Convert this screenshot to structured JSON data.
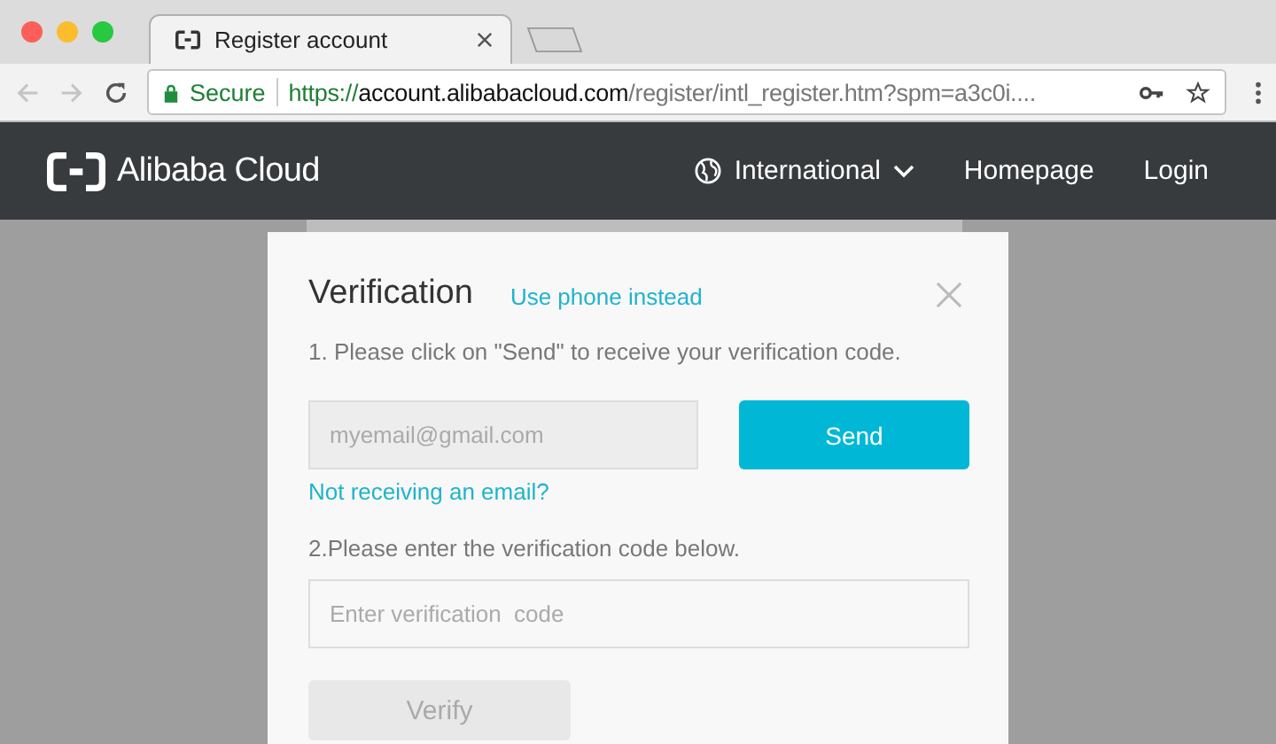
{
  "browser": {
    "tab": {
      "title": "Register account",
      "selected": true
    },
    "address_bar": {
      "security": "Secure",
      "url_scheme": "https://",
      "url_host": "account.alibabacloud.com",
      "url_path": "/register/intl_register.htm?spm=a3c0i...."
    }
  },
  "header": {
    "logo": "Alibaba Cloud",
    "nav": [
      {
        "label": "International",
        "kind": "region"
      },
      {
        "label": "Homepage",
        "kind": "link"
      },
      {
        "label": "Login",
        "kind": "link"
      }
    ]
  },
  "dialog": {
    "title": "Verification",
    "switch_link": "Use phone instead",
    "step1": "1. Please click on \"Send\" to receive your verification code.",
    "email_field": {
      "placeholder": "myemail@gmail.com"
    },
    "send_button": {
      "label": "Send",
      "disabled": false
    },
    "help_link": "Not receiving an email?",
    "step2": "2.Please enter the verification code below.",
    "code_field": {
      "placeholder": "Enter verification  code"
    },
    "verify_button": {
      "label": "Verify",
      "disabled": true
    }
  }
}
